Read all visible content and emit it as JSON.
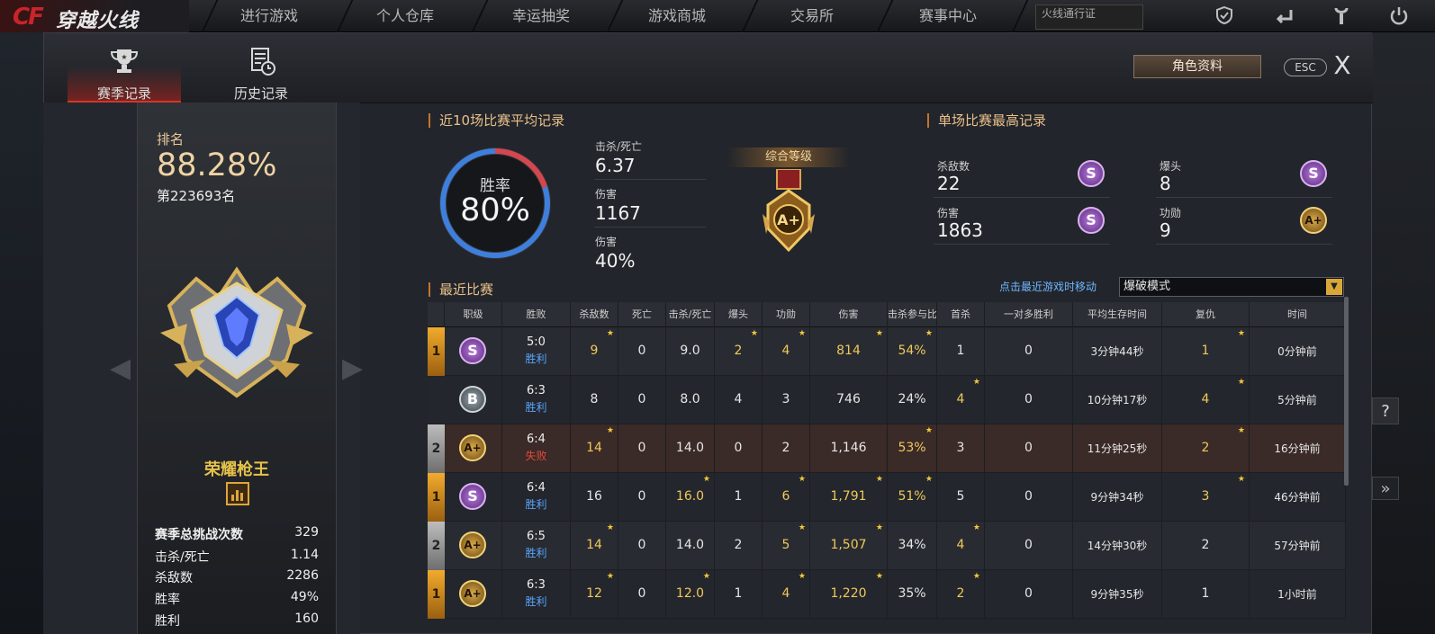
{
  "topnav": {
    "logo_latin": "CF",
    "logo_text": "穿越火线",
    "items": [
      "进行游戏",
      "个人仓库",
      "幸运抽奖",
      "游戏商城",
      "交易所",
      "赛事中心"
    ],
    "season_pass": "火线通行证"
  },
  "dialog": {
    "tabs": [
      {
        "label": "赛季记录",
        "icon": "trophy-icon"
      },
      {
        "label": "历史记录",
        "icon": "history-icon"
      }
    ],
    "profile_button": "角色资料",
    "esc_label": "ESC",
    "close_label": "X"
  },
  "left": {
    "rank_label": "排名",
    "rank_percent": "88.28%",
    "rank_position": "第223693名",
    "badge_name": "荣耀枪王",
    "stats": [
      {
        "label": "赛季总挑战次数",
        "value": "329"
      },
      {
        "label": "击杀/死亡",
        "value": "1.14"
      },
      {
        "label": "杀敌数",
        "value": "2286"
      },
      {
        "label": "胜率",
        "value": "49%"
      },
      {
        "label": "胜利",
        "value": "160"
      }
    ]
  },
  "avg": {
    "title": "近10场比赛平均记录",
    "win_rate_label": "胜率",
    "win_rate": "80%",
    "win_rate_fraction": 0.8,
    "kd_label": "击杀/死亡",
    "kd": "6.37",
    "damage_label": "伤害",
    "damage": "1167",
    "damage2_label": "伤害",
    "damage2": "40%",
    "grade_title": "综合等级",
    "grade": "A+"
  },
  "best": {
    "title": "单场比赛最高记录",
    "items": [
      {
        "label": "杀敌数",
        "value": "22",
        "grade": "S"
      },
      {
        "label": "爆头",
        "value": "8",
        "grade": "S"
      },
      {
        "label": "伤害",
        "value": "1863",
        "grade": "S"
      },
      {
        "label": "功勋",
        "value": "9",
        "grade": "A+"
      }
    ]
  },
  "recent": {
    "title": "最近比赛",
    "move_link": "点击最近游戏时移动",
    "mode": "爆破模式",
    "columns": [
      "职级",
      "胜败",
      "杀敌数",
      "死亡",
      "击杀/死亡",
      "爆头",
      "功勋",
      "伤害",
      "击杀参与比",
      "首杀",
      "一对多胜利",
      "平均生存时间",
      "复仇",
      "时间"
    ],
    "rows": [
      {
        "rank": "1",
        "grade": "S",
        "score": "5:0",
        "result": "胜利",
        "win": true,
        "kills": "9",
        "deaths": "0",
        "kd": "9.0",
        "hs": "2",
        "merit": "4",
        "dmg": "814",
        "part": "54%",
        "first": "1",
        "clutch": "0",
        "surv": "3分钟44秒",
        "revenge": "1",
        "time": "0分钟前"
      },
      {
        "rank": "",
        "grade": "B",
        "score": "6:3",
        "result": "胜利",
        "win": true,
        "kills": "8",
        "deaths": "0",
        "kd": "8.0",
        "hs": "4",
        "merit": "3",
        "dmg": "746",
        "part": "24%",
        "first": "4",
        "clutch": "0",
        "surv": "10分钟17秒",
        "revenge": "4",
        "time": "5分钟前"
      },
      {
        "rank": "2",
        "grade": "A+",
        "score": "6:4",
        "result": "失败",
        "win": false,
        "kills": "14",
        "deaths": "0",
        "kd": "14.0",
        "hs": "0",
        "merit": "2",
        "dmg": "1,146",
        "part": "53%",
        "first": "3",
        "clutch": "0",
        "surv": "11分钟25秒",
        "revenge": "2",
        "time": "16分钟前"
      },
      {
        "rank": "1",
        "grade": "S",
        "score": "6:4",
        "result": "胜利",
        "win": true,
        "kills": "16",
        "deaths": "0",
        "kd": "16.0",
        "hs": "1",
        "merit": "6",
        "dmg": "1,791",
        "part": "51%",
        "first": "5",
        "clutch": "0",
        "surv": "9分钟34秒",
        "revenge": "3",
        "time": "46分钟前"
      },
      {
        "rank": "2",
        "grade": "A+",
        "score": "6:5",
        "result": "胜利",
        "win": true,
        "kills": "14",
        "deaths": "0",
        "kd": "14.0",
        "hs": "2",
        "merit": "5",
        "dmg": "1,507",
        "part": "34%",
        "first": "4",
        "clutch": "0",
        "surv": "14分钟30秒",
        "revenge": "2",
        "time": "57分钟前"
      },
      {
        "rank": "1",
        "grade": "A+",
        "score": "6:3",
        "result": "胜利",
        "win": true,
        "kills": "12",
        "deaths": "0",
        "kd": "12.0",
        "hs": "1",
        "merit": "4",
        "dmg": "1,220",
        "part": "35%",
        "first": "2",
        "clutch": "0",
        "surv": "9分钟35秒",
        "revenge": "1",
        "time": "1小时前"
      }
    ]
  },
  "colors": {
    "accent": "#d6352a",
    "gold": "#e8c08a",
    "win": "#5aa6ff",
    "lose": "#e24a3a"
  }
}
